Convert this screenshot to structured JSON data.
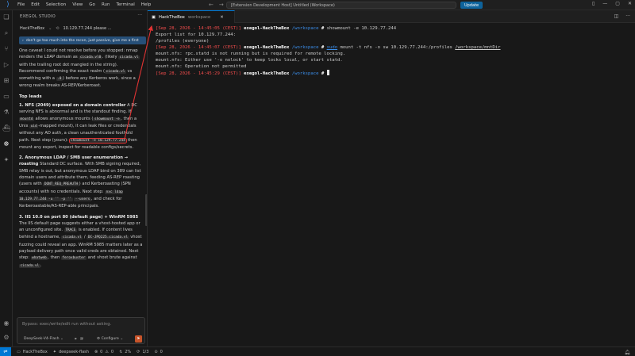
{
  "menubar": [
    "File",
    "Edit",
    "Selection",
    "View",
    "Go",
    "Run",
    "Terminal",
    "Help"
  ],
  "command_center": "[Extension Development Host] Untitled (Workspace)",
  "update_label": "Update",
  "panel": {
    "title": "EXEGOL STUDIO",
    "session_name": "HackTheBox",
    "session_target": "10.129.77.244 please ...",
    "tip": "don't go too much into the recon, just passive, give me a first",
    "chat": {
      "p1_a": "One caveat I could not resolve before you stopped:",
      "p1_b": "nmap renders the LDAP domain as ",
      "p1_c1": "cicada.vl0",
      "p1_d": ". (likely ",
      "p1_c2": "cicada.vl",
      "p1_e": " with the trailing root dot mangled in the string). Recommend confirming the exact realm (",
      "p1_c3": "cicada.vl",
      "p1_f": " vs something with a ",
      "p1_c4": ".0",
      "p1_g": ") before any Kerberos work, since a wrong realm breaks AS-REP/Kerberoast.",
      "top_leads": "Top leads",
      "l1_title": "1. NFS (2049) exposed on a domain controller",
      "l1_a": " A DC serving NFS is abnormal and is the standout finding. If ",
      "l1_c1": "mountd",
      "l1_b": " allows anonymous mounts (",
      "l1_c2": "showmount -e",
      "l1_c": ", then a Unix ",
      "l1_c3": "uid",
      "l1_d": "-mapped mount), it can leak files or credentials without any AD auth, a clean unauthenticated foothold path. Next step (yours):",
      "l1_cmd": "showmount -e 10.129.77.244",
      "l1_e": " then mount any export, inspect for readable configs/secrets.",
      "l2_title": "2. Anonymous LDAP / SMB user enumeration → roasting",
      "l2_a": " Standard DC surface. With SMB signing required, SMB relay is out, but anonymous LDAP bind on 389 can list domain users and attribute them, feeding AS-REP roasting (users with ",
      "l2_c1": "DONT_REQ_PREAUTH",
      "l2_b": ") and Kerberoasting (SPN accounts) with no credentials. Next step: ",
      "l2_c2": "nxc ldap 10.129.77.244 -u '' -p ''",
      "l2_c": " ",
      "l2_c3": "--users",
      "l2_d": ", and check for Kerberoastable/AS-REP-able principals.",
      "l3_title": "3. IIS 10.0 on port 80 (default page) + WinRM 5985",
      "l3_a": " The IIS default page suggests either a vhost-hosted app or an unconfigured site. ",
      "l3_c1": "TRACE",
      "l3_b": " is enabled. If content lives behind a hostname, ",
      "l3_c2": "cicada.vl",
      "l3_c": " / ",
      "l3_c3": "DC-JPQ225.cicada.vl",
      "l3_d": " vhost fuzzing could reveal an app. WinRM 5985 matters later as a payload delivery path once valid creds are obtained. Next step: ",
      "l3_c4": "whatweb",
      "l3_e": ", then ",
      "l3_c5": "feroxbuster",
      "l3_f": " and vhost brute against ",
      "l3_c6": "cicada.vl",
      "l3_g": "."
    },
    "input_placeholder": "Bypass: exec/write/edit run without asking.",
    "model": "DeepSeek-V4-Flash",
    "configure": "Configure"
  },
  "tab": {
    "label": "HackTheBox",
    "sublabel": "workspace"
  },
  "terminal": {
    "lines": [
      {
        "ts": "[Sep 28, 2026 - 14:45:05 (CEST)]",
        "host": "exegol-HackTheBox",
        "path": "/workspace",
        "cmd": "showmount -e 10.129.77.244"
      },
      {
        "out": "Export list for 10.129.77.244:"
      },
      {
        "out": "/profiles (everyone)"
      },
      {
        "ts": "[Sep 28, 2026 - 14:45:07 (CEST)]",
        "host": "exegol-HackTheBox",
        "path": "/workspace",
        "cmd_sudo": "sudo",
        "cmd": " mount -t nfs -o sw 10.129.77.244:/profiles ",
        "cmd_ul": "/workspace/mntDir"
      },
      {
        "out": "mount.nfs: rpc.statd is not running but is required for remote locking."
      },
      {
        "out": "mount.nfs: Either use '-o nolock' to keep locks local, or start statd."
      },
      {
        "out": "mount.nfs: Operation not permitted"
      },
      {
        "ts": "[Sep 28, 2026 - 14:45:29 (CEST)]",
        "host": "exegol-HackTheBox",
        "path": "/workspace",
        "cmd": ""
      }
    ]
  },
  "statusbar": {
    "branch": "HackTheBox",
    "model": "deepseek-flash",
    "errors": "0",
    "warnings": "0",
    "pct": "2%",
    "pages": "1/3",
    "num": "0"
  }
}
